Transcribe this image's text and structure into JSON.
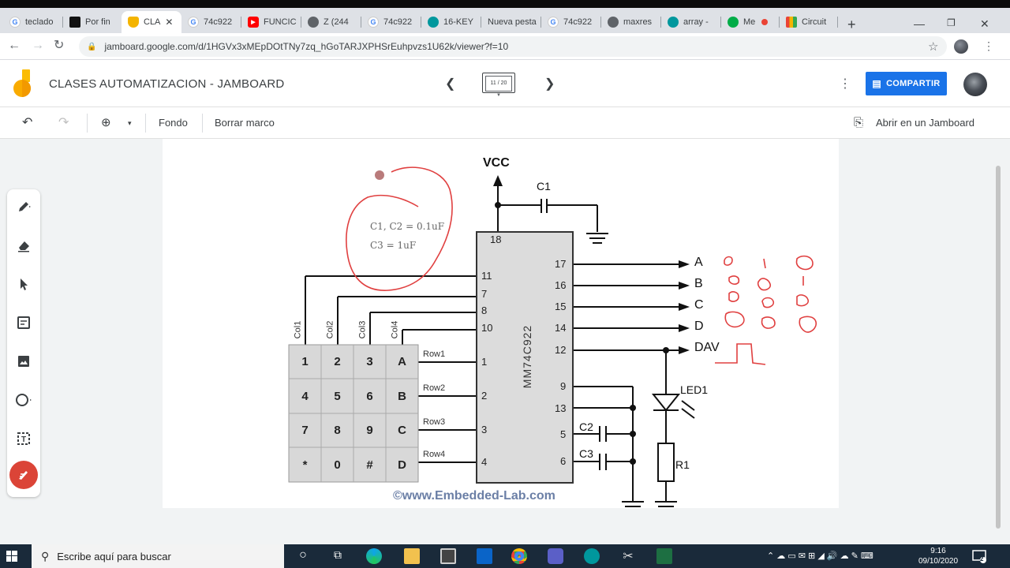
{
  "browser": {
    "tabs": [
      {
        "label": "teclado",
        "icon": "google-icon",
        "color": "#4285f4",
        "glyph": "G"
      },
      {
        "label": "Por fin",
        "icon": "black-app-icon",
        "color": "#111111",
        "glyph": ""
      },
      {
        "label": "CLA",
        "icon": "jamboard-icon",
        "color": "#f4b400",
        "glyph": "",
        "active": true
      },
      {
        "label": "74c922",
        "icon": "google-icon",
        "color": "#4285f4",
        "glyph": "G"
      },
      {
        "label": "FUNCIC",
        "icon": "youtube-icon",
        "color": "#ff0000",
        "glyph": "▶"
      },
      {
        "label": "Z (244",
        "icon": "globe-icon",
        "color": "#5f6368",
        "glyph": ""
      },
      {
        "label": "74c922",
        "icon": "google-icon",
        "color": "#4285f4",
        "glyph": "G"
      },
      {
        "label": "16-KEY",
        "icon": "arduino-icon",
        "color": "#00979d",
        "glyph": ""
      },
      {
        "label": "Nueva pesta",
        "icon": "none",
        "color": "",
        "glyph": ""
      },
      {
        "label": "74c922",
        "icon": "google-icon",
        "color": "#4285f4",
        "glyph": "G"
      },
      {
        "label": "maxres",
        "icon": "globe-icon",
        "color": "#5f6368",
        "glyph": ""
      },
      {
        "label": "array -",
        "icon": "arduino-icon",
        "color": "#00979d",
        "glyph": ""
      },
      {
        "label": "Me",
        "icon": "meet-icon",
        "color": "#00ac47",
        "glyph": ""
      },
      {
        "label": "Circuit",
        "icon": "grid-app-icon",
        "color": "#f4b400",
        "glyph": ""
      }
    ],
    "url": "jamboard.google.com/d/1HGVx3xMEpDOtTNy7zq_hGoTARJXPHSrEuhpvzs1U62k/viewer?f=10"
  },
  "jamboard": {
    "title": "CLASES AUTOMATIZACION - JAMBOARD",
    "frame_counter": "11 / 20",
    "share_label": "COMPARTIR",
    "toolbar": {
      "background_label": "Fondo",
      "clear_label": "Borrar marco",
      "open_label": "Abrir en un Jamboard"
    },
    "brand_color": "#1a73e8",
    "laser_color": "#db4437"
  },
  "diagram": {
    "vcc": "VCC",
    "c1": "C1",
    "c2": "C2",
    "c3": "C3",
    "r1": "R1",
    "led": "LED1",
    "chip": "MM74C922",
    "pin18": "18",
    "right_pins": [
      "17",
      "16",
      "15",
      "14",
      "12"
    ],
    "outputs": [
      "A",
      "B",
      "C",
      "D",
      "DAV"
    ],
    "left_pins": [
      "11",
      "7",
      "8",
      "10"
    ],
    "row_pins": [
      "1",
      "2",
      "3",
      "4"
    ],
    "lower_pins": [
      "9",
      "13",
      "5",
      "6"
    ],
    "cols": [
      "Col1",
      "Col2",
      "Col3",
      "Col4"
    ],
    "rows": [
      "Row1",
      "Row2",
      "Row3",
      "Row4"
    ],
    "keys": [
      [
        "1",
        "2",
        "3",
        "A"
      ],
      [
        "4",
        "5",
        "6",
        "B"
      ],
      [
        "7",
        "8",
        "9",
        "C"
      ],
      [
        "*",
        "0",
        "#",
        "D"
      ]
    ],
    "watermark": "©www.Embedded-Lab.com",
    "note_line1": "C1, C2 = 0.1uF",
    "note_line2": "C3 = 1uF"
  },
  "taskbar": {
    "search_placeholder": "Escribe aquí para buscar",
    "time": "9:16",
    "date": "09/10/2020",
    "notif_count": "2"
  }
}
